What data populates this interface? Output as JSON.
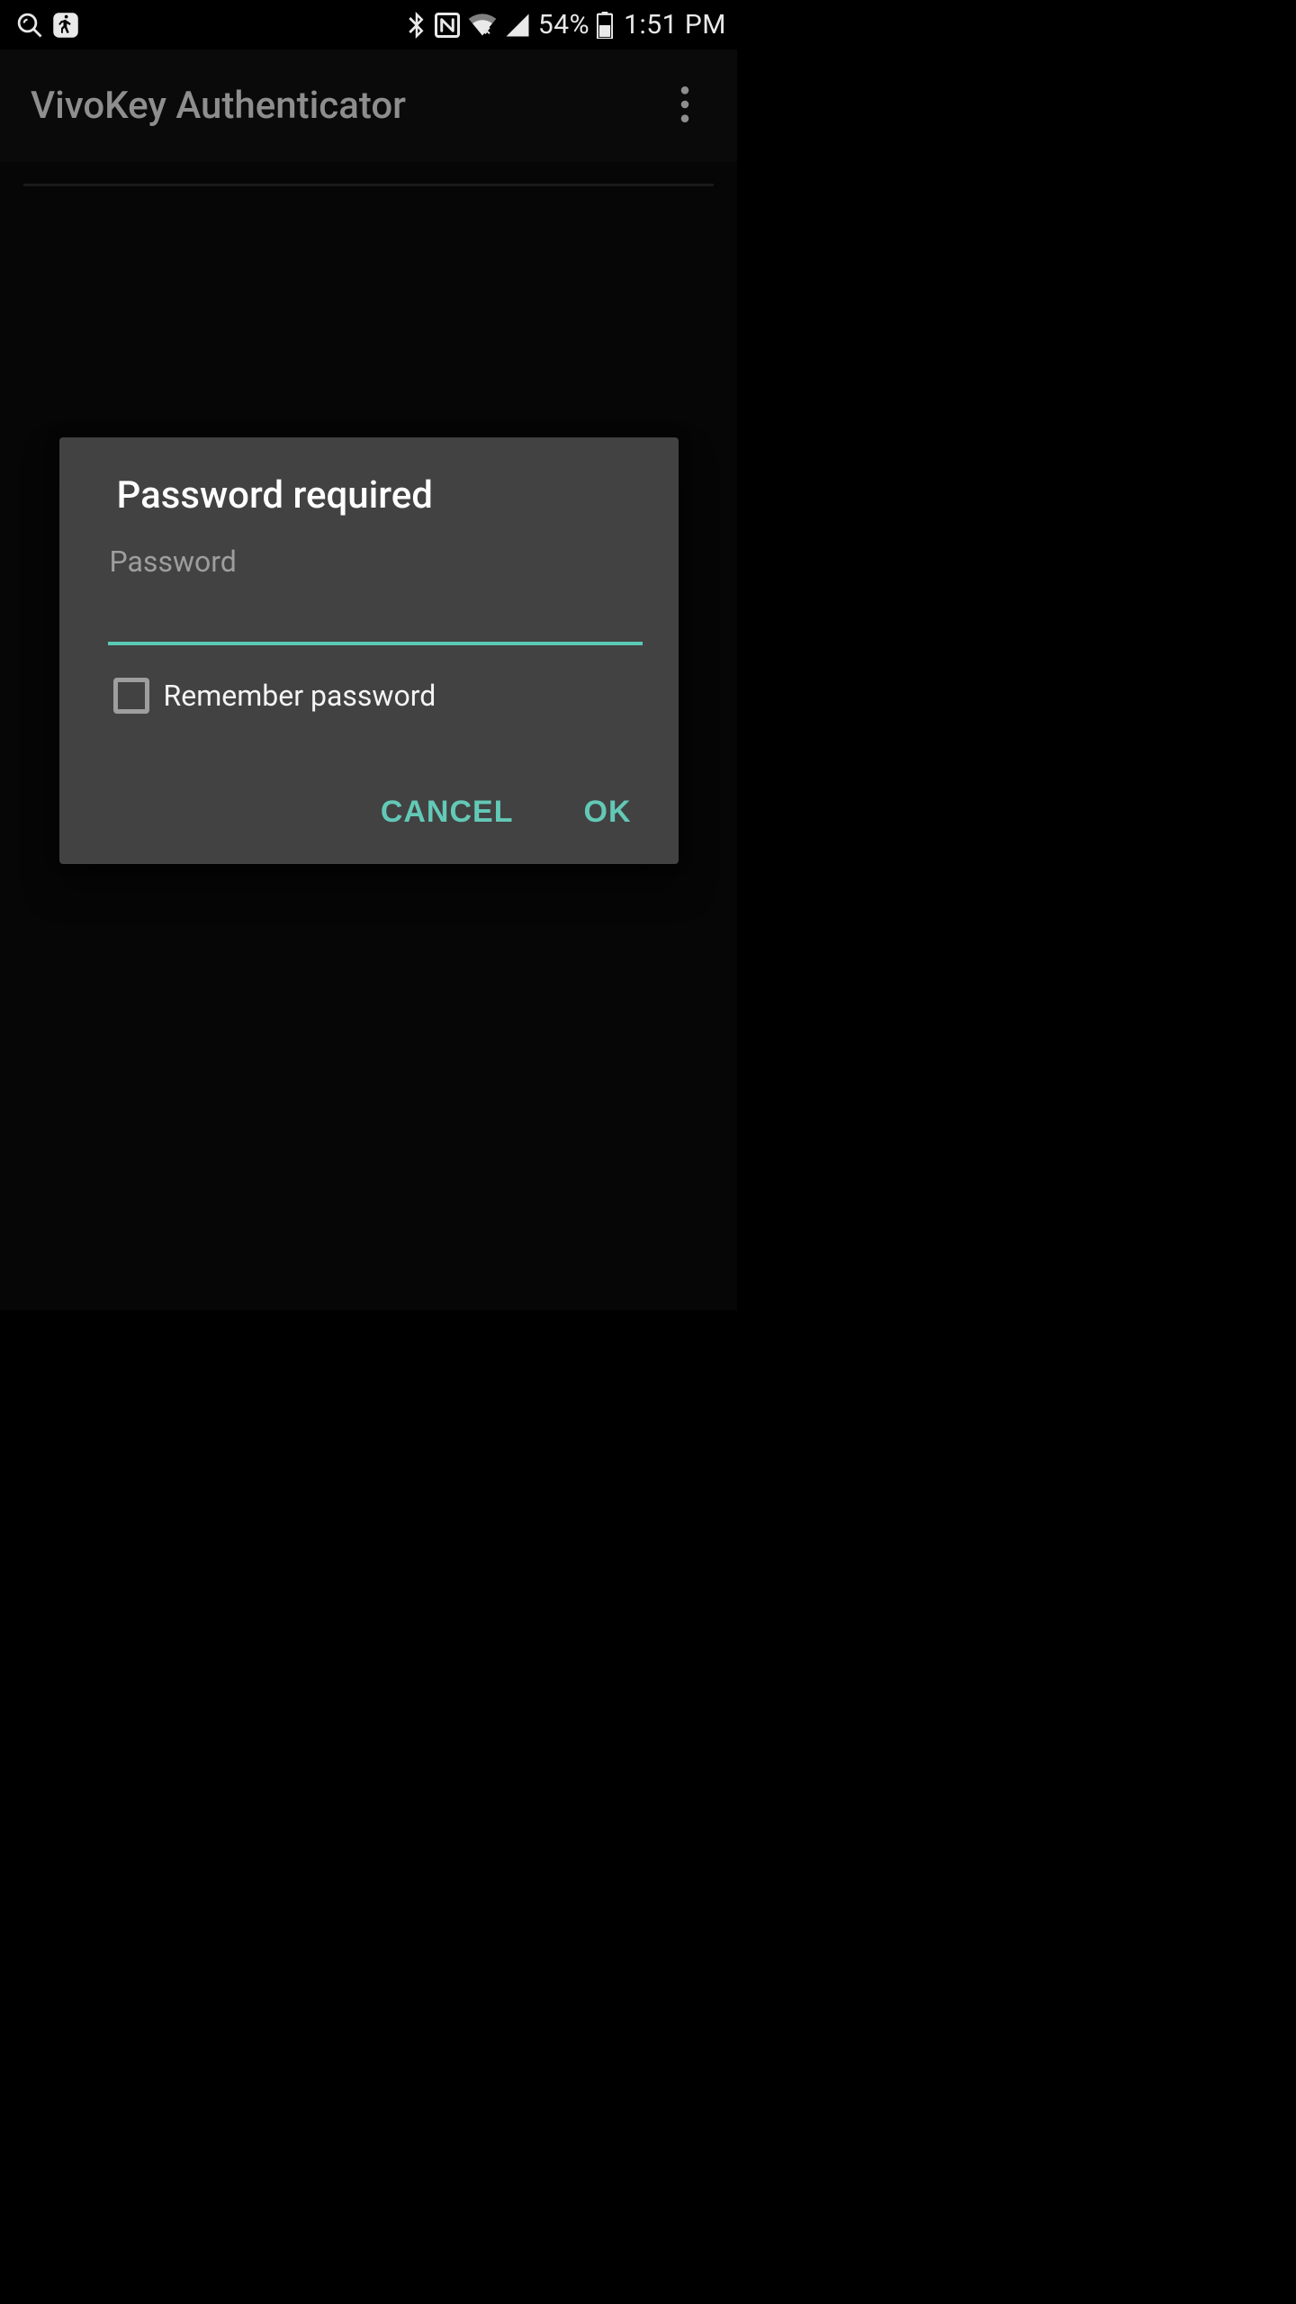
{
  "status_bar": {
    "battery_text": "54%",
    "time_text": "1:51 PM"
  },
  "app_bar": {
    "title": "VivoKey Authenticator"
  },
  "dialog": {
    "title": "Password required",
    "field_label": "Password",
    "password_value": "",
    "remember_label": "Remember password",
    "remember_checked": false,
    "cancel_label": "CANCEL",
    "ok_label": "OK"
  },
  "colors": {
    "accent": "#5bc9b5",
    "dialog_bg": "#424242",
    "status_fg": "#e9e9e9"
  }
}
